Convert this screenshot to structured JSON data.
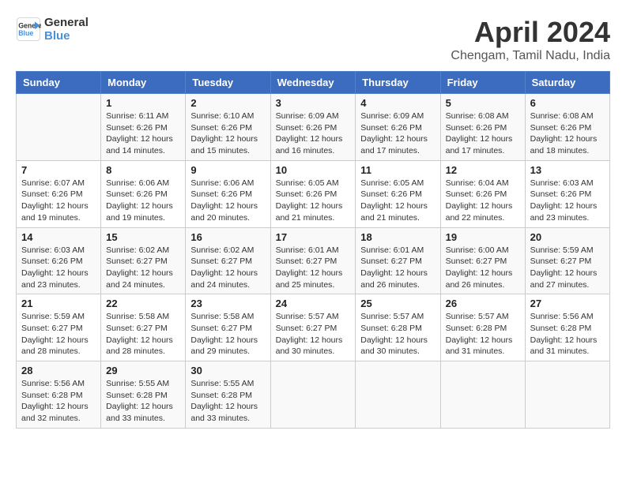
{
  "header": {
    "logo_line1": "General",
    "logo_line2": "Blue",
    "month_title": "April 2024",
    "location": "Chengam, Tamil Nadu, India"
  },
  "columns": [
    "Sunday",
    "Monday",
    "Tuesday",
    "Wednesday",
    "Thursday",
    "Friday",
    "Saturday"
  ],
  "weeks": [
    [
      {
        "day": "",
        "info": ""
      },
      {
        "day": "1",
        "info": "Sunrise: 6:11 AM\nSunset: 6:26 PM\nDaylight: 12 hours\nand 14 minutes."
      },
      {
        "day": "2",
        "info": "Sunrise: 6:10 AM\nSunset: 6:26 PM\nDaylight: 12 hours\nand 15 minutes."
      },
      {
        "day": "3",
        "info": "Sunrise: 6:09 AM\nSunset: 6:26 PM\nDaylight: 12 hours\nand 16 minutes."
      },
      {
        "day": "4",
        "info": "Sunrise: 6:09 AM\nSunset: 6:26 PM\nDaylight: 12 hours\nand 17 minutes."
      },
      {
        "day": "5",
        "info": "Sunrise: 6:08 AM\nSunset: 6:26 PM\nDaylight: 12 hours\nand 17 minutes."
      },
      {
        "day": "6",
        "info": "Sunrise: 6:08 AM\nSunset: 6:26 PM\nDaylight: 12 hours\nand 18 minutes."
      }
    ],
    [
      {
        "day": "7",
        "info": "Sunrise: 6:07 AM\nSunset: 6:26 PM\nDaylight: 12 hours\nand 19 minutes."
      },
      {
        "day": "8",
        "info": "Sunrise: 6:06 AM\nSunset: 6:26 PM\nDaylight: 12 hours\nand 19 minutes."
      },
      {
        "day": "9",
        "info": "Sunrise: 6:06 AM\nSunset: 6:26 PM\nDaylight: 12 hours\nand 20 minutes."
      },
      {
        "day": "10",
        "info": "Sunrise: 6:05 AM\nSunset: 6:26 PM\nDaylight: 12 hours\nand 21 minutes."
      },
      {
        "day": "11",
        "info": "Sunrise: 6:05 AM\nSunset: 6:26 PM\nDaylight: 12 hours\nand 21 minutes."
      },
      {
        "day": "12",
        "info": "Sunrise: 6:04 AM\nSunset: 6:26 PM\nDaylight: 12 hours\nand 22 minutes."
      },
      {
        "day": "13",
        "info": "Sunrise: 6:03 AM\nSunset: 6:26 PM\nDaylight: 12 hours\nand 23 minutes."
      }
    ],
    [
      {
        "day": "14",
        "info": "Sunrise: 6:03 AM\nSunset: 6:26 PM\nDaylight: 12 hours\nand 23 minutes."
      },
      {
        "day": "15",
        "info": "Sunrise: 6:02 AM\nSunset: 6:27 PM\nDaylight: 12 hours\nand 24 minutes."
      },
      {
        "day": "16",
        "info": "Sunrise: 6:02 AM\nSunset: 6:27 PM\nDaylight: 12 hours\nand 24 minutes."
      },
      {
        "day": "17",
        "info": "Sunrise: 6:01 AM\nSunset: 6:27 PM\nDaylight: 12 hours\nand 25 minutes."
      },
      {
        "day": "18",
        "info": "Sunrise: 6:01 AM\nSunset: 6:27 PM\nDaylight: 12 hours\nand 26 minutes."
      },
      {
        "day": "19",
        "info": "Sunrise: 6:00 AM\nSunset: 6:27 PM\nDaylight: 12 hours\nand 26 minutes."
      },
      {
        "day": "20",
        "info": "Sunrise: 5:59 AM\nSunset: 6:27 PM\nDaylight: 12 hours\nand 27 minutes."
      }
    ],
    [
      {
        "day": "21",
        "info": "Sunrise: 5:59 AM\nSunset: 6:27 PM\nDaylight: 12 hours\nand 28 minutes."
      },
      {
        "day": "22",
        "info": "Sunrise: 5:58 AM\nSunset: 6:27 PM\nDaylight: 12 hours\nand 28 minutes."
      },
      {
        "day": "23",
        "info": "Sunrise: 5:58 AM\nSunset: 6:27 PM\nDaylight: 12 hours\nand 29 minutes."
      },
      {
        "day": "24",
        "info": "Sunrise: 5:57 AM\nSunset: 6:27 PM\nDaylight: 12 hours\nand 30 minutes."
      },
      {
        "day": "25",
        "info": "Sunrise: 5:57 AM\nSunset: 6:28 PM\nDaylight: 12 hours\nand 30 minutes."
      },
      {
        "day": "26",
        "info": "Sunrise: 5:57 AM\nSunset: 6:28 PM\nDaylight: 12 hours\nand 31 minutes."
      },
      {
        "day": "27",
        "info": "Sunrise: 5:56 AM\nSunset: 6:28 PM\nDaylight: 12 hours\nand 31 minutes."
      }
    ],
    [
      {
        "day": "28",
        "info": "Sunrise: 5:56 AM\nSunset: 6:28 PM\nDaylight: 12 hours\nand 32 minutes."
      },
      {
        "day": "29",
        "info": "Sunrise: 5:55 AM\nSunset: 6:28 PM\nDaylight: 12 hours\nand 33 minutes."
      },
      {
        "day": "30",
        "info": "Sunrise: 5:55 AM\nSunset: 6:28 PM\nDaylight: 12 hours\nand 33 minutes."
      },
      {
        "day": "",
        "info": ""
      },
      {
        "day": "",
        "info": ""
      },
      {
        "day": "",
        "info": ""
      },
      {
        "day": "",
        "info": ""
      }
    ]
  ]
}
